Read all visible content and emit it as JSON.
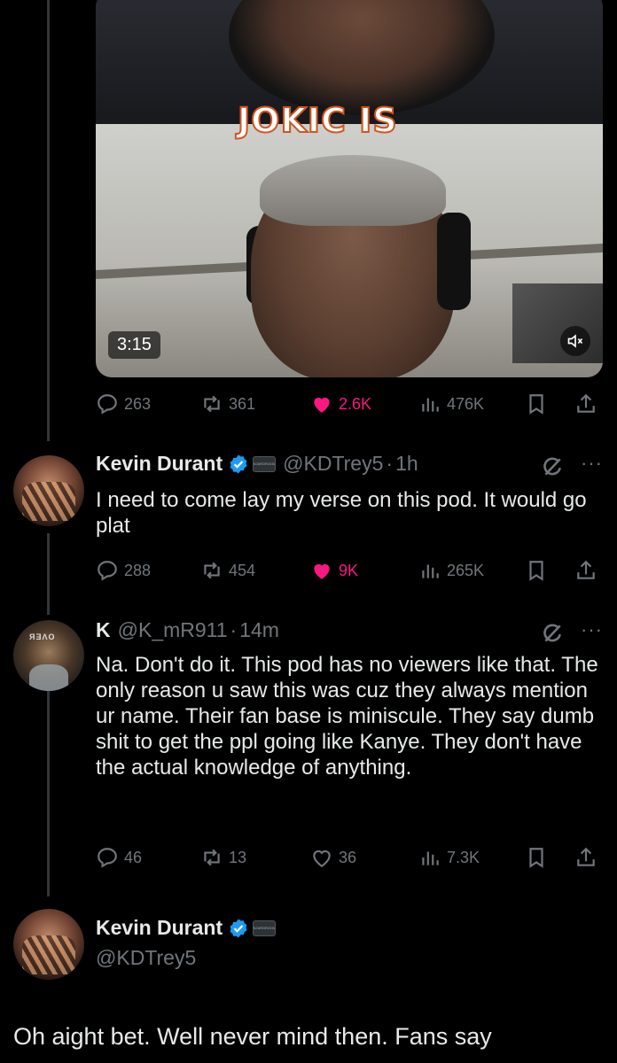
{
  "video": {
    "caption": "JOKIC IS",
    "timecode": "3:15"
  },
  "tweet0": {
    "stats": {
      "replies": "263",
      "reposts": "361",
      "likes": "2.6K",
      "views": "476K"
    }
  },
  "tweet1": {
    "name": "Kevin Durant",
    "badge_text": "BOARDROOM",
    "handle": "@KDTrey5",
    "dot": "·",
    "time": "1h",
    "text": "I need to come lay my verse on this pod. It would go plat",
    "stats": {
      "replies": "288",
      "reposts": "454",
      "likes": "9K",
      "views": "265K"
    }
  },
  "tweet2": {
    "name": "K",
    "avatar_text": "ЯƎΛО",
    "handle": "@K_mR911",
    "dot": "·",
    "time": "14m",
    "text": "Na. Don't do it. This pod has no viewers like that. The only reason u saw this was cuz they always mention ur name. Their fan base is miniscule. They say dumb shit to get the ppl going like Kanye. They don't have the actual knowledge of anything.",
    "stats": {
      "replies": "46",
      "reposts": "13",
      "likes": "36",
      "views": "7.3K"
    }
  },
  "tweet3": {
    "name": "Kevin Durant",
    "badge_text": "BOARDROOM",
    "handle": "@KDTrey5",
    "text": "Oh aight bet. Well never mind then. Fans say"
  },
  "colors": {
    "background": "#000000",
    "text": "#e7e9ea",
    "muted": "#71767b",
    "like": "#f91880",
    "verified": "#1d9bf0"
  },
  "icons": [
    "reply-icon",
    "repost-icon",
    "like-icon",
    "views-icon",
    "bookmark-icon",
    "share-icon",
    "grok-icon",
    "more-icon",
    "verified-icon",
    "mute-icon"
  ]
}
